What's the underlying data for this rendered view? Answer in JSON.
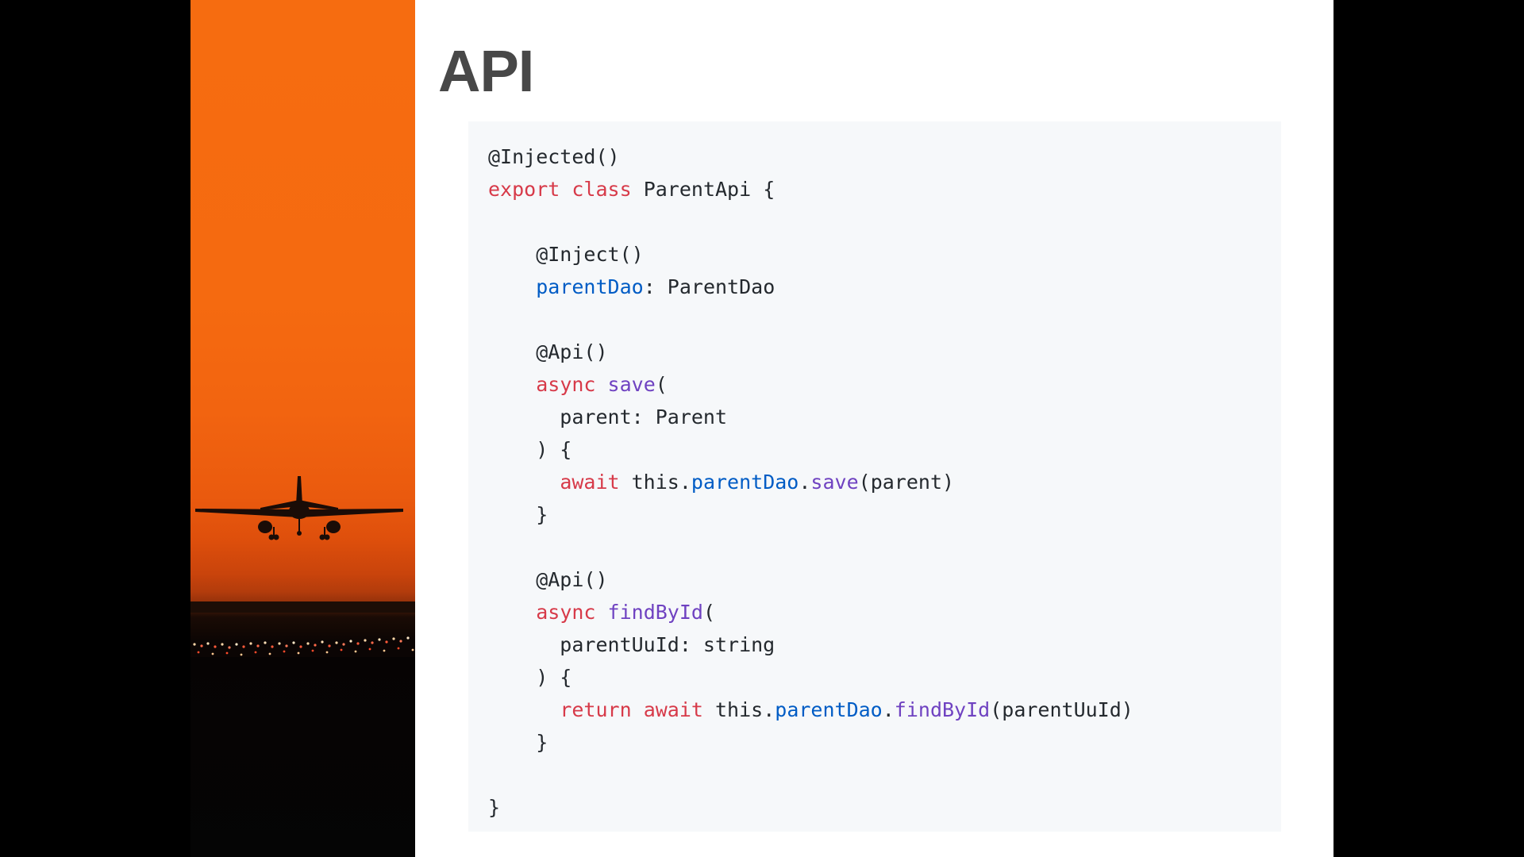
{
  "slide": {
    "title": "API"
  },
  "colors": {
    "background": "#000000",
    "slide_background": "#ffffff",
    "title": "#484848",
    "code_background": "#f6f8fa",
    "code_text": "#24292e",
    "keyword": "#d73a49",
    "function": "#6f42c1",
    "property": "#005cc5",
    "sky_orange": "#f66c10"
  },
  "image": {
    "subject": "airplane-landing-at-sunset",
    "icon": "airplane-silhouette-icon"
  },
  "code": {
    "lines": [
      [
        {
          "t": "@Injected()",
          "k": "plain"
        }
      ],
      [
        {
          "t": "export",
          "k": "kw"
        },
        {
          "t": " ",
          "k": "plain"
        },
        {
          "t": "class",
          "k": "kw"
        },
        {
          "t": " ParentApi {",
          "k": "plain"
        }
      ],
      [],
      [
        {
          "t": "    @Inject()",
          "k": "plain"
        }
      ],
      [
        {
          "t": "    ",
          "k": "plain"
        },
        {
          "t": "parentDao",
          "k": "prop"
        },
        {
          "t": ": ParentDao",
          "k": "plain"
        }
      ],
      [],
      [
        {
          "t": "    @Api()",
          "k": "plain"
        }
      ],
      [
        {
          "t": "    ",
          "k": "plain"
        },
        {
          "t": "async",
          "k": "kw"
        },
        {
          "t": " ",
          "k": "plain"
        },
        {
          "t": "save",
          "k": "fn"
        },
        {
          "t": "(",
          "k": "plain"
        }
      ],
      [
        {
          "t": "      parent: Parent",
          "k": "plain"
        }
      ],
      [
        {
          "t": "    ) {",
          "k": "plain"
        }
      ],
      [
        {
          "t": "      ",
          "k": "plain"
        },
        {
          "t": "await",
          "k": "kw"
        },
        {
          "t": " this.",
          "k": "plain"
        },
        {
          "t": "parentDao",
          "k": "prop"
        },
        {
          "t": ".",
          "k": "plain"
        },
        {
          "t": "save",
          "k": "fn"
        },
        {
          "t": "(parent)",
          "k": "plain"
        }
      ],
      [
        {
          "t": "    }",
          "k": "plain"
        }
      ],
      [],
      [
        {
          "t": "    @Api()",
          "k": "plain"
        }
      ],
      [
        {
          "t": "    ",
          "k": "plain"
        },
        {
          "t": "async",
          "k": "kw"
        },
        {
          "t": " ",
          "k": "plain"
        },
        {
          "t": "findById",
          "k": "fn"
        },
        {
          "t": "(",
          "k": "plain"
        }
      ],
      [
        {
          "t": "      parentUuId: string",
          "k": "plain"
        }
      ],
      [
        {
          "t": "    ) {",
          "k": "plain"
        }
      ],
      [
        {
          "t": "      ",
          "k": "plain"
        },
        {
          "t": "return",
          "k": "kw"
        },
        {
          "t": " ",
          "k": "plain"
        },
        {
          "t": "await",
          "k": "kw"
        },
        {
          "t": " this.",
          "k": "plain"
        },
        {
          "t": "parentDao",
          "k": "prop"
        },
        {
          "t": ".",
          "k": "plain"
        },
        {
          "t": "findById",
          "k": "fn"
        },
        {
          "t": "(parentUuId)",
          "k": "plain"
        }
      ],
      [
        {
          "t": "    }",
          "k": "plain"
        }
      ],
      [],
      [
        {
          "t": "}",
          "k": "plain"
        }
      ]
    ]
  }
}
